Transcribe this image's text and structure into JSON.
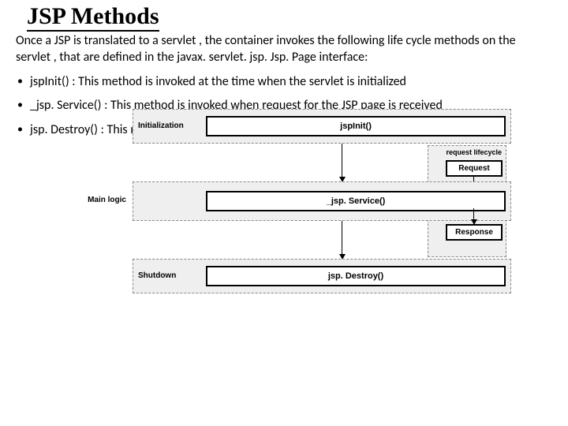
{
  "title": "JSP Methods",
  "intro": "Once a JSP is translated to a servlet , the container invokes the following life cycle methods on the servlet , that are defined in the javax. servlet. jsp. Jsp. Page interface:",
  "bullets": [
    "jspInit() :  This method is invoked at the time  when the servlet is initialized",
    "_jsp. Service() : This method is invoked when request for the JSP page is received",
    "jsp. Destroy() : This method is invoked before the  servlet is removed from the service"
  ],
  "diagram": {
    "side_label": "Main logic",
    "phases": [
      {
        "label": "Initialization",
        "method": "jspInit()"
      },
      {
        "label": "",
        "method": "_jsp. Service()"
      },
      {
        "label": "Shutdown",
        "method": "jsp. Destroy()"
      }
    ],
    "lifecycle_label": "request lifecycle",
    "request_label": "Request",
    "response_label": "Response"
  }
}
